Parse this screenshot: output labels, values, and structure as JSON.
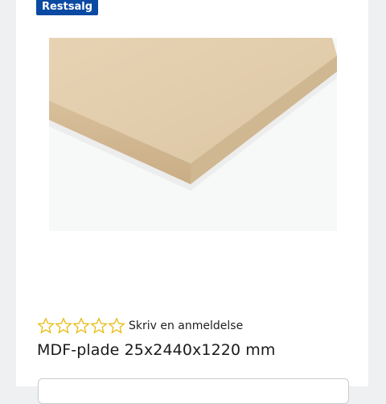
{
  "badge": {
    "label": "Restsalg",
    "color": "#0b4aa2"
  },
  "product_image": {
    "icon": "mdf-board-image"
  },
  "rating": {
    "stars_filled": 0,
    "stars_total": 5,
    "review_link": "Skriv en anmeldelse"
  },
  "product": {
    "title": "MDF-plade 25x2440x1220 mm"
  }
}
